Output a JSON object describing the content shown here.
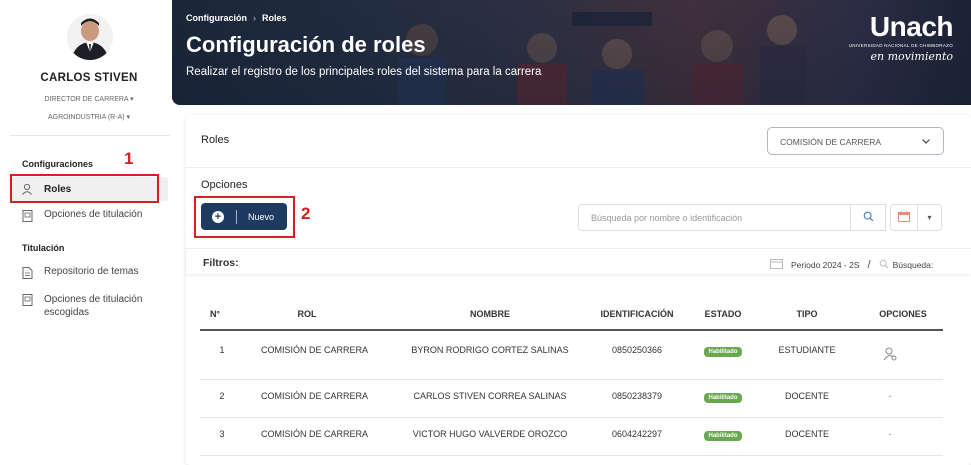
{
  "sidebar": {
    "user_name": "CARLOS STIVEN",
    "role": "DIRECTOR DE CARRERA",
    "career": "AGROINDUSTRIA (R-A)",
    "sections": [
      {
        "title": "Configuraciones",
        "items": [
          {
            "label": "Roles",
            "icon": "user-icon",
            "active": true
          },
          {
            "label": "Opciones de titulación",
            "icon": "document-icon"
          }
        ]
      },
      {
        "title": "Titulación",
        "items": [
          {
            "label": "Repositorio de temas",
            "icon": "file-list-icon"
          },
          {
            "label": "Opciones de titulación escogidas",
            "icon": "document-icon"
          }
        ]
      }
    ]
  },
  "banner": {
    "breadcrumb": [
      "Configuración",
      "Roles"
    ],
    "title": "Configuración de roles",
    "subtitle": "Realizar el registro de los principales roles del sistema para la carrera",
    "logo": {
      "name": "Unach",
      "subtitle": "UNIVERSIDAD NACIONAL DE CHIMBORAZO",
      "tagline": "en movimiento"
    }
  },
  "main": {
    "title": "Roles",
    "role_select": "COMISIÓN DE CARRERA",
    "options_label": "Opciones",
    "new_button": "Nuevo",
    "search_placeholder": "Búsqueda por nombre o identificación",
    "filters_label": "Filtros:",
    "period": "Periodo 2024 - 2S",
    "period_sep": "/",
    "search_label": "Búsqueda:"
  },
  "table": {
    "headers": [
      "N°",
      "ROL",
      "NOMBRE",
      "IDENTIFICACIÓN",
      "ESTADO",
      "TIPO",
      "OPCIONES"
    ],
    "rows": [
      {
        "n": "1",
        "rol": "COMISIÓN DE CARRERA",
        "nombre": "BYRON RODRIGO CORTEZ SALINAS",
        "id": "0850250366",
        "estado": "Habilitado",
        "tipo": "ESTUDIANTE",
        "opciones": ""
      },
      {
        "n": "2",
        "rol": "COMISIÓN DE CARRERA",
        "nombre": "CARLOS STIVEN CORREA SALINAS",
        "id": "0850238379",
        "estado": "Habilitado",
        "tipo": "DOCENTE",
        "opciones": "-"
      },
      {
        "n": "3",
        "rol": "COMISIÓN DE CARRERA",
        "nombre": "VICTOR HUGO VALVERDE OROZCO",
        "id": "0604242297",
        "estado": "Habilitado",
        "tipo": "DOCENTE",
        "opciones": "-"
      }
    ]
  },
  "annotations": [
    "1",
    "2"
  ],
  "colors": {
    "primary": "#1f3a60",
    "badge": "#6aa84f",
    "annotation": "#d51f26"
  }
}
